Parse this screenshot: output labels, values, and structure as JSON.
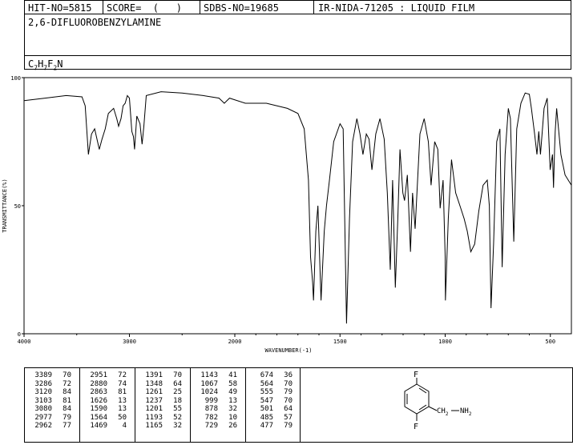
{
  "header": {
    "hit_no": "HIT-NO=5815",
    "score": "SCORE=  (   )",
    "sdbs_no": "SDBS-NO=19685",
    "ir_no": "IR-NIDA-71205 : LIQUID FILM"
  },
  "compound": {
    "name": "2,6-DIFLUOROBENZYLAMINE",
    "formula": {
      "c": "C",
      "c_n": "7",
      "h": "H",
      "h_n": "7",
      "f": "F",
      "f_n": "2",
      "n": "N"
    }
  },
  "chart_data": {
    "type": "line",
    "xlabel": "WAVENUMBER(-1)",
    "ylabel": "TRANSMITTANCE(%)",
    "xlim": [
      4000,
      400
    ],
    "ylim": [
      0,
      100
    ],
    "x_reversed": true,
    "x_ticks": [
      "4000",
      "3000",
      "2000",
      "1500",
      "1000",
      "500"
    ],
    "y_ticks": [
      "100",
      "50",
      "0"
    ],
    "series": [
      {
        "points": [
          [
            4000,
            91
          ],
          [
            3800,
            92
          ],
          [
            3600,
            93
          ],
          [
            3450,
            92.5
          ],
          [
            3420,
            89
          ],
          [
            3389,
            70
          ],
          [
            3360,
            78
          ],
          [
            3330,
            80
          ],
          [
            3286,
            72
          ],
          [
            3260,
            76
          ],
          [
            3230,
            80
          ],
          [
            3200,
            86
          ],
          [
            3150,
            88
          ],
          [
            3120,
            84
          ],
          [
            3103,
            81
          ],
          [
            3080,
            84
          ],
          [
            3060,
            89
          ],
          [
            3040,
            90
          ],
          [
            3020,
            93
          ],
          [
            3000,
            92
          ],
          [
            2977,
            79
          ],
          [
            2962,
            77
          ],
          [
            2951,
            72
          ],
          [
            2930,
            85
          ],
          [
            2900,
            82
          ],
          [
            2880,
            74
          ],
          [
            2863,
            81
          ],
          [
            2840,
            93
          ],
          [
            2700,
            94.5
          ],
          [
            2500,
            94
          ],
          [
            2300,
            93
          ],
          [
            2150,
            92
          ],
          [
            2100,
            90
          ],
          [
            2050,
            92
          ],
          [
            1950,
            90
          ],
          [
            1850,
            90
          ],
          [
            1750,
            88
          ],
          [
            1700,
            86
          ],
          [
            1670,
            80
          ],
          [
            1650,
            60
          ],
          [
            1640,
            30
          ],
          [
            1630,
            20
          ],
          [
            1626,
            13
          ],
          [
            1615,
            40
          ],
          [
            1605,
            50
          ],
          [
            1590,
            13
          ],
          [
            1575,
            40
          ],
          [
            1564,
            50
          ],
          [
            1550,
            60
          ],
          [
            1530,
            75
          ],
          [
            1500,
            82
          ],
          [
            1485,
            80
          ],
          [
            1469,
            4
          ],
          [
            1455,
            45
          ],
          [
            1440,
            75
          ],
          [
            1420,
            84
          ],
          [
            1405,
            78
          ],
          [
            1391,
            70
          ],
          [
            1375,
            78
          ],
          [
            1362,
            76
          ],
          [
            1348,
            64
          ],
          [
            1330,
            78
          ],
          [
            1310,
            84
          ],
          [
            1290,
            76
          ],
          [
            1275,
            55
          ],
          [
            1261,
            25
          ],
          [
            1250,
            60
          ],
          [
            1237,
            18
          ],
          [
            1225,
            45
          ],
          [
            1215,
            72
          ],
          [
            1201,
            55
          ],
          [
            1193,
            52
          ],
          [
            1180,
            62
          ],
          [
            1165,
            32
          ],
          [
            1155,
            55
          ],
          [
            1143,
            41
          ],
          [
            1120,
            78
          ],
          [
            1100,
            84
          ],
          [
            1080,
            75
          ],
          [
            1067,
            58
          ],
          [
            1050,
            75
          ],
          [
            1035,
            72
          ],
          [
            1024,
            49
          ],
          [
            1010,
            60
          ],
          [
            1000,
            30
          ],
          [
            999,
            13
          ],
          [
            985,
            45
          ],
          [
            970,
            68
          ],
          [
            950,
            55
          ],
          [
            930,
            50
          ],
          [
            910,
            45
          ],
          [
            895,
            40
          ],
          [
            878,
            32
          ],
          [
            860,
            35
          ],
          [
            840,
            48
          ],
          [
            820,
            58
          ],
          [
            800,
            60
          ],
          [
            790,
            50
          ],
          [
            782,
            10
          ],
          [
            770,
            35
          ],
          [
            755,
            75
          ],
          [
            740,
            80
          ],
          [
            729,
            26
          ],
          [
            715,
            70
          ],
          [
            700,
            88
          ],
          [
            690,
            84
          ],
          [
            674,
            36
          ],
          [
            660,
            80
          ],
          [
            640,
            90
          ],
          [
            620,
            94
          ],
          [
            600,
            93.5
          ],
          [
            590,
            88
          ],
          [
            575,
            78
          ],
          [
            564,
            70
          ],
          [
            555,
            79
          ],
          [
            547,
            70
          ],
          [
            530,
            88
          ],
          [
            515,
            92
          ],
          [
            501,
            64
          ],
          [
            490,
            70
          ],
          [
            485,
            57
          ],
          [
            480,
            72
          ],
          [
            477,
            79
          ],
          [
            470,
            88
          ],
          [
            450,
            70
          ],
          [
            430,
            62
          ],
          [
            400,
            58
          ]
        ]
      }
    ]
  },
  "peaks": {
    "columns": [
      [
        [
          "3389",
          "70"
        ],
        [
          "3286",
          "72"
        ],
        [
          "3120",
          "84"
        ],
        [
          "3103",
          "81"
        ],
        [
          "3080",
          "84"
        ],
        [
          "2977",
          "79"
        ],
        [
          "2962",
          "77"
        ]
      ],
      [
        [
          "2951",
          "72"
        ],
        [
          "2880",
          "74"
        ],
        [
          "2863",
          "81"
        ],
        [
          "1626",
          "13"
        ],
        [
          "1590",
          "13"
        ],
        [
          "1564",
          "50"
        ],
        [
          "1469",
          "4"
        ]
      ],
      [
        [
          "1391",
          "70"
        ],
        [
          "1348",
          "64"
        ],
        [
          "1261",
          "25"
        ],
        [
          "1237",
          "18"
        ],
        [
          "1201",
          "55"
        ],
        [
          "1193",
          "52"
        ],
        [
          "1165",
          "32"
        ]
      ],
      [
        [
          "1143",
          "41"
        ],
        [
          "1067",
          "58"
        ],
        [
          "1024",
          "49"
        ],
        [
          "999",
          "13"
        ],
        [
          "878",
          "32"
        ],
        [
          "782",
          "10"
        ],
        [
          "729",
          "26"
        ]
      ],
      [
        [
          "674",
          "36"
        ],
        [
          "564",
          "70"
        ],
        [
          "555",
          "79"
        ],
        [
          "547",
          "70"
        ],
        [
          "501",
          "64"
        ],
        [
          "485",
          "57"
        ],
        [
          "477",
          "79"
        ]
      ]
    ]
  },
  "structure": {
    "f_top": "F",
    "f_bottom": "F",
    "ch2": "CH",
    "ch2_sub": "2",
    "nh": "NH",
    "nh_sub": "2"
  }
}
